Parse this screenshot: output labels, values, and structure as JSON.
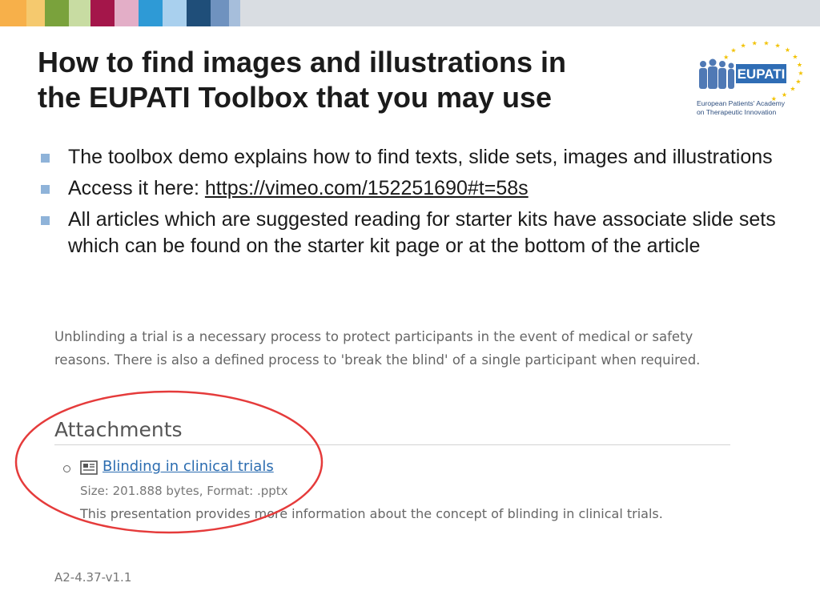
{
  "colors": {
    "strip": [
      "#f7b04a",
      "#f5c96e",
      "#7aa23c",
      "#c8dca2",
      "#a4164a",
      "#e3aec7",
      "#2e9ad6",
      "#a9d0ee",
      "#1f4e79",
      "#6f92bf",
      "#a6bedb",
      "#d9dde2"
    ],
    "bullet": "#8fb3d9",
    "circle": "#e53b3b",
    "link": "#2b6cb0"
  },
  "slide": {
    "title_line1": "How to find images and illustrations in",
    "title_line2": "the EUPATI Toolbox that you may use",
    "bullets": [
      "The toolbox demo explains how to find texts, slide sets, images and illustrations",
      "All articles which are suggested reading for starter kits have associate slide sets which can be found on the starter kit page or at the bottom of the article"
    ],
    "access_prefix": "Access it here: ",
    "access_link": "https://vimeo.com/152251690#t=58s"
  },
  "logo": {
    "name": "EUPATI",
    "tagline_line1": "European Patients' Academy",
    "tagline_line2": "on Therapeutic Innovation"
  },
  "screenshot": {
    "intro": "Unblinding a trial is a necessary process to protect participants in the event of medical or safety reasons. There is also a defined process to 'break the blind' of a single participant when required.",
    "attachments_heading": "Attachments",
    "attachment_link": "Blinding in clinical trials",
    "attachment_meta": "Size: 201.888 bytes, Format: .pptx",
    "attachment_desc": "This presentation provides more information about the concept of blinding in clinical trials.",
    "doc_icon": "document-icon"
  },
  "footer": {
    "version": "A2-4.37-v1.1"
  }
}
